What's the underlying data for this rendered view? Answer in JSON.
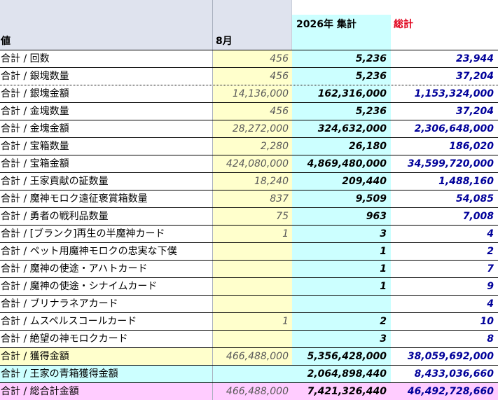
{
  "header": {
    "label_col": "値",
    "aug_col": "8月",
    "sum_col": "2026年 集計",
    "total_col": "総計"
  },
  "colors": {
    "aug_fill": "#ffffcc",
    "sum_fill": "#ccffff",
    "total_text": "#00009a",
    "total_header": "#e0001b",
    "grand_total_fill": "#ffccff"
  },
  "rows": [
    {
      "label": "合計 / 回数",
      "aug": "456",
      "sum": "5,236",
      "total": "23,944"
    },
    {
      "label": "合計 / 銀塊数量",
      "aug": "456",
      "sum": "5,236",
      "total": "37,204"
    },
    {
      "label": "合計 / 銀塊金額",
      "aug": "14,136,000",
      "sum": "162,316,000",
      "total": "1,153,324,000"
    },
    {
      "label": "合計 / 金塊数量",
      "aug": "456",
      "sum": "5,236",
      "total": "37,204"
    },
    {
      "label": "合計 / 金塊金額",
      "aug": "28,272,000",
      "sum": "324,632,000",
      "total": "2,306,648,000"
    },
    {
      "label": "合計 / 宝箱数量",
      "aug": "2,280",
      "sum": "26,180",
      "total": "186,020"
    },
    {
      "label": "合計 / 宝箱金額",
      "aug": "424,080,000",
      "sum": "4,869,480,000",
      "total": "34,599,720,000"
    },
    {
      "label": "合計 / 王家貢献の証数量",
      "aug": "18,240",
      "sum": "209,440",
      "total": "1,488,160"
    },
    {
      "label": "合計 / 魔神モロク遠征褒賞箱数量",
      "aug": "837",
      "sum": "9,509",
      "total": "54,085"
    },
    {
      "label": "合計 / 勇者の戦利品数量",
      "aug": "75",
      "sum": "963",
      "total": "7,008"
    },
    {
      "label": "合計 / [ブランク]再生の半魔神カード",
      "aug": "1",
      "sum": "3",
      "total": "4"
    },
    {
      "label": "合計 / ペット用魔神モロクの忠実な下僕",
      "aug": "",
      "sum": "1",
      "total": "2"
    },
    {
      "label": "合計 / 魔神の使途・アハトカード",
      "aug": "",
      "sum": "1",
      "total": "7"
    },
    {
      "label": "合計 / 魔神の使途・シナイムカード",
      "aug": "",
      "sum": "1",
      "total": "9"
    },
    {
      "label": "合計 / ブリナラネアカード",
      "aug": "",
      "sum": "",
      "total": "4"
    },
    {
      "label": "合計 / ムスペルスコールカード",
      "aug": "1",
      "sum": "2",
      "total": "10"
    },
    {
      "label": "合計 / 絶望の神モロクカード",
      "aug": "",
      "sum": "3",
      "total": "8"
    },
    {
      "label": "合計 / 獲得金額",
      "aug": "466,488,000",
      "sum": "5,356,428,000",
      "total": "38,059,692,000"
    },
    {
      "label": "合計 / 王家の青箱獲得金額",
      "aug": "",
      "sum": "2,064,898,440",
      "total": "8,433,036,660"
    },
    {
      "label": "合計 / 総合計金額",
      "aug": "466,488,000",
      "sum": "7,421,326,440",
      "total": "46,492,728,660"
    }
  ]
}
